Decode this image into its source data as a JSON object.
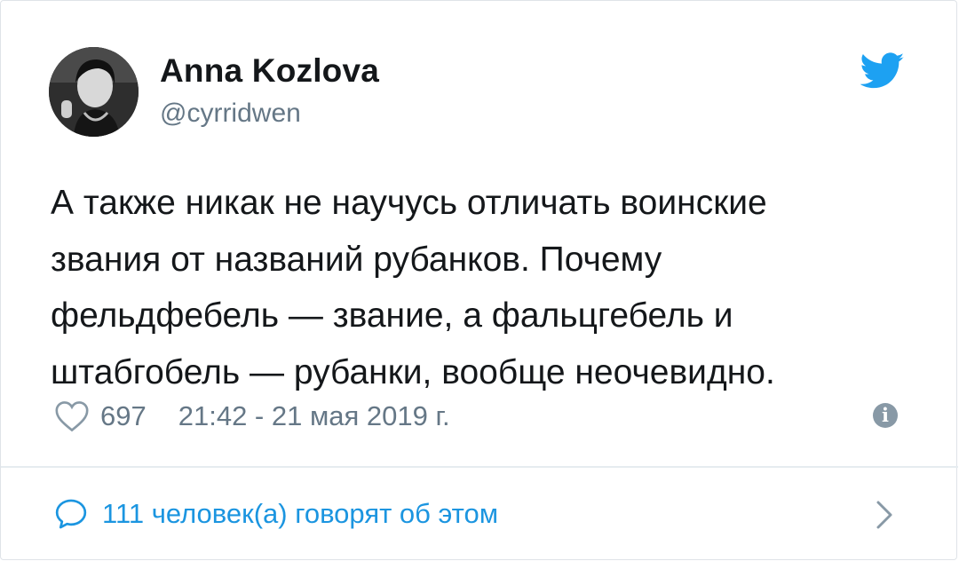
{
  "tweet": {
    "author": {
      "name": "Anna Kozlova",
      "handle": "@cyrridwen"
    },
    "text": "А также никак не научусь отличать воинские\nзвания от названий рубанков. Почему\nфельдфебель — звание, а фальцгебель и\nштабгобель — рубанки, вообще неочевидно.",
    "likes": "697",
    "timestamp": "21:42 - 21 мая 2019 г.",
    "replies_text": "111 человек(а) говорят об этом",
    "info_glyph": "i"
  },
  "icons": {
    "brand": "twitter-bird-icon",
    "like": "heart-icon",
    "info": "info-icon",
    "reply": "speech-bubble-icon",
    "chevron": "chevron-right-icon"
  },
  "colors": {
    "brand": "#1da1f2",
    "link": "#1b95e0",
    "secondary_text": "#657786"
  }
}
